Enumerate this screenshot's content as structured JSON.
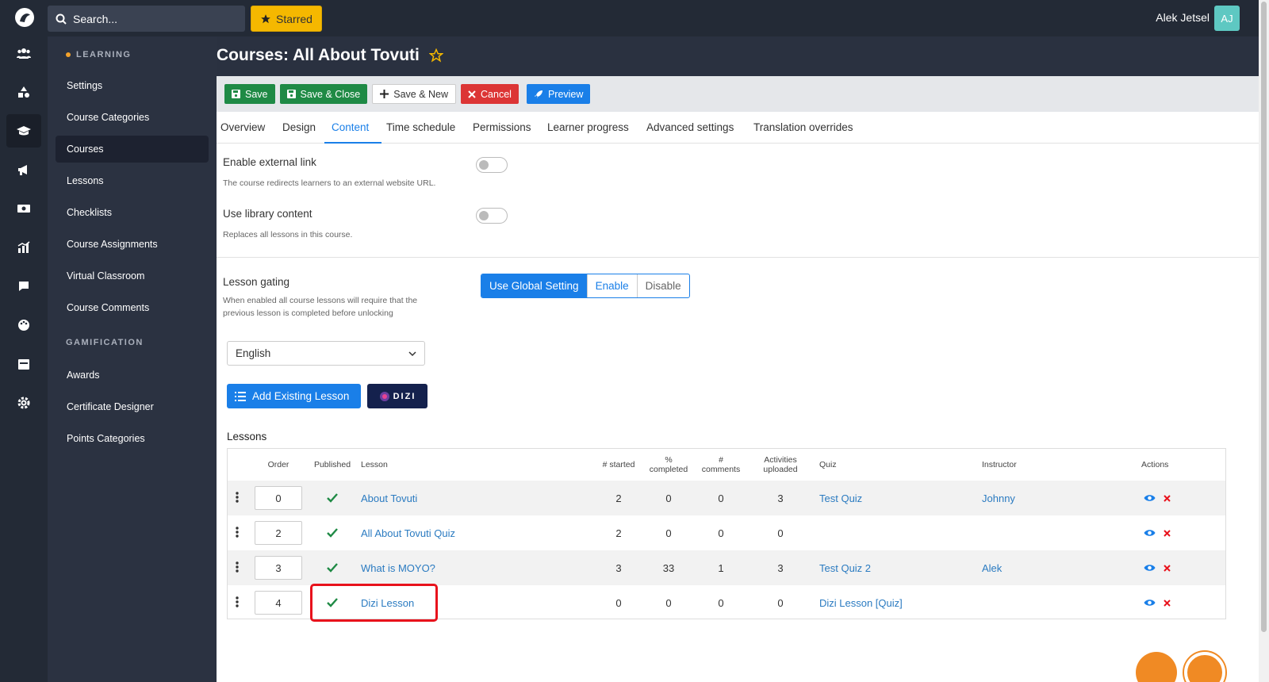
{
  "topbar": {
    "search_placeholder": "Search...",
    "starred_label": "Starred",
    "user_name": "Alek Jetsel",
    "user_initials": "AJ"
  },
  "sidebar": {
    "section_learning": "LEARNING",
    "section_gamification": "GAMIFICATION",
    "learning_items": [
      "Settings",
      "Course Categories",
      "Courses",
      "Lessons",
      "Checklists",
      "Course Assignments",
      "Virtual Classroom",
      "Course Comments"
    ],
    "gamification_items": [
      "Awards",
      "Certificate Designer",
      "Points Categories"
    ],
    "active_item": "Courses"
  },
  "page": {
    "title": "Courses: All About Tovuti"
  },
  "toolbar": {
    "save": "Save",
    "save_close": "Save & Close",
    "save_new": "Save & New",
    "cancel": "Cancel",
    "preview": "Preview"
  },
  "tabs": [
    "Overview",
    "Design",
    "Content",
    "Time schedule",
    "Permissions",
    "Learner progress",
    "Advanced settings",
    "Translation overrides"
  ],
  "active_tab": "Content",
  "content": {
    "external_link_label": "Enable external link",
    "external_link_help": "The course redirects learners to an external website URL.",
    "library_label": "Use library content",
    "library_help": "Replaces all lessons in this course.",
    "gating_label": "Lesson gating",
    "gating_help_1": "When enabled all course lessons will require that the",
    "gating_help_2": "previous lesson is completed before unlocking",
    "gating_options": [
      "Use Global Setting",
      "Enable",
      "Disable"
    ],
    "gating_selected": "Use Global Setting",
    "language": "English",
    "add_existing_lesson": "Add Existing Lesson",
    "dizi_label": "DIZI",
    "lessons_title": "Lessons"
  },
  "table": {
    "headers": {
      "order": "Order",
      "published": "Published",
      "lesson": "Lesson",
      "started": "# started",
      "completed_1": "%",
      "completed_2": "completed",
      "comments_1": "#",
      "comments_2": "comments",
      "activities_1": "Activities",
      "activities_2": "uploaded",
      "quiz": "Quiz",
      "instructor": "Instructor",
      "actions": "Actions"
    },
    "rows": [
      {
        "order": "0",
        "lesson": "About Tovuti",
        "started": "2",
        "completed": "0",
        "comments": "0",
        "activities": "3",
        "quiz": "Test Quiz",
        "instructor": "Johnny"
      },
      {
        "order": "2",
        "lesson": "All About Tovuti Quiz",
        "started": "2",
        "completed": "0",
        "comments": "0",
        "activities": "0",
        "quiz": "",
        "instructor": ""
      },
      {
        "order": "3",
        "lesson": "What is MOYO?",
        "started": "3",
        "completed": "33",
        "comments": "1",
        "activities": "3",
        "quiz": "Test Quiz 2",
        "instructor": "Alek"
      },
      {
        "order": "4",
        "lesson": "Dizi Lesson",
        "started": "0",
        "completed": "0",
        "comments": "0",
        "activities": "0",
        "quiz": "Dizi Lesson [Quiz]",
        "instructor": ""
      }
    ]
  },
  "colors": {
    "accent": "#1a7fe8",
    "success": "#1f8a45",
    "danger": "#dc3535",
    "highlight": "#e8121c"
  }
}
